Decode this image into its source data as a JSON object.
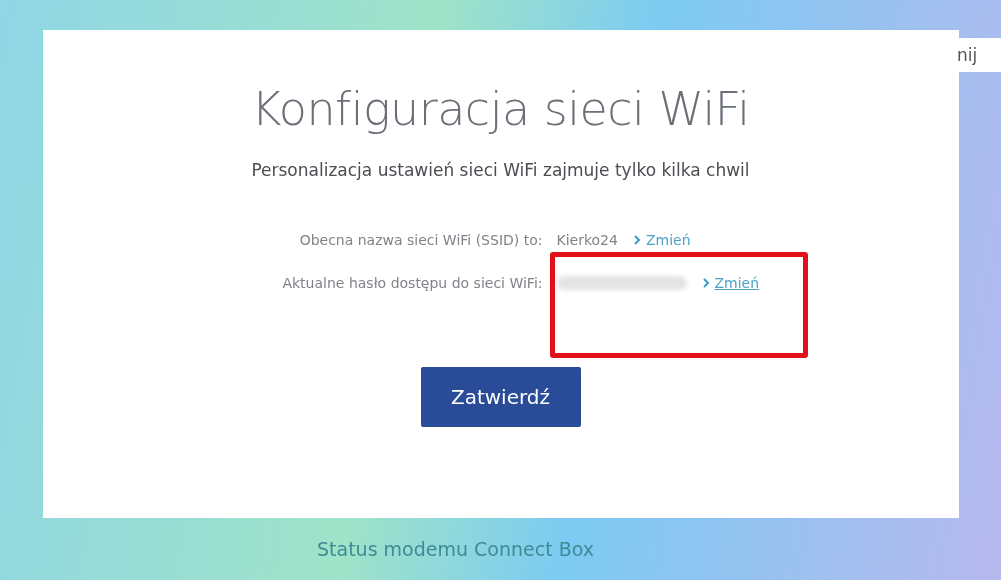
{
  "dialog": {
    "title": "Konfiguracja sieci WiFi",
    "subtitle": "Personalizacja ustawień sieci WiFi zajmuje tylko kilka chwil",
    "rows": [
      {
        "label": "Obecna nazwa sieci WiFi (SSID) to:",
        "kind": "text",
        "value": "Kierko24",
        "link": "Zmień",
        "underlined": false
      },
      {
        "label": "Aktualne hasło dostępu do sieci WiFi:",
        "kind": "hidden",
        "link": "Zmień",
        "underlined": true
      }
    ],
    "confirm_button": "Zatwierdź"
  },
  "close_tab": "nij",
  "footer": "Status modemu Connect Box"
}
